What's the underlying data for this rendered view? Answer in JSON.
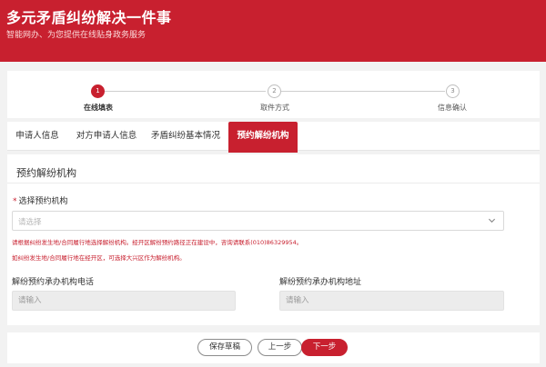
{
  "header": {
    "title": "多元矛盾纠纷解决一件事",
    "subtitle": "智能网办、为您提供在线贴身政务服务"
  },
  "steps": [
    {
      "number": "1",
      "label": "在线填表",
      "active": true
    },
    {
      "number": "2",
      "label": "取件方式",
      "active": false
    },
    {
      "number": "3",
      "label": "信息确认",
      "active": false
    }
  ],
  "tabs": [
    {
      "label": "申请人信息",
      "active": false
    },
    {
      "label": "对方申请人信息",
      "active": false
    },
    {
      "label": "矛盾纠纷基本情况",
      "active": false
    },
    {
      "label": "预约解纷机构",
      "active": true
    }
  ],
  "form": {
    "section_title": "预约解纷机构",
    "select_org": {
      "required_mark": "*",
      "label": "选择预约机构",
      "placeholder": "请选择"
    },
    "notes": [
      "请根据纠纷发生地/合同履行地选择解纷机构。经开区解纷预约路径正在建设中，咨询请联系(010)86329954。",
      "如纠纷发生地/合同履行地在经开区，可选择大兴区作为解纷机构。"
    ],
    "phone": {
      "label": "解纷预约承办机构电话",
      "placeholder": "请输入"
    },
    "address": {
      "label": "解纷预约承办机构地址",
      "placeholder": "请输入"
    }
  },
  "footer": {
    "save_draft": "保存草稿",
    "prev": "上一步",
    "next": "下一步"
  },
  "colors": {
    "brand": "#c8202f",
    "background": "#f2f2f2"
  },
  "icons": {
    "select_chevron": "chevron-down-icon"
  }
}
